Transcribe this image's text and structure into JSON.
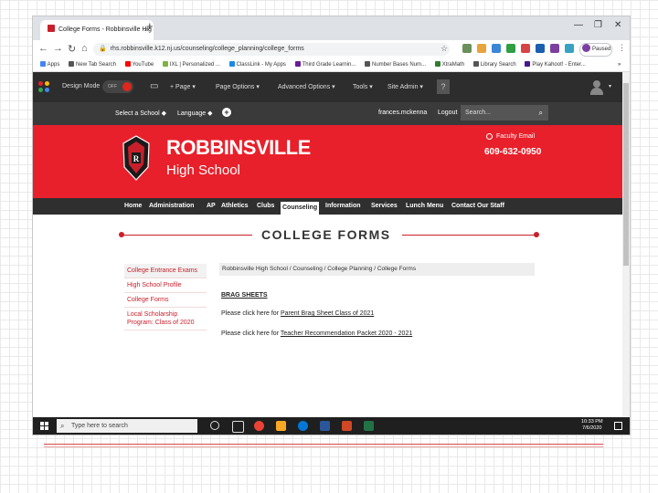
{
  "browser": {
    "tab_title": "College Forms - Robbinsville Hig",
    "tab_close": "×",
    "new_tab": "+",
    "window_controls": [
      "—",
      "❐",
      "✕"
    ],
    "url": "rhs.robbinsville.k12.nj.us/counseling/college_planning/college_forms",
    "profile_label": "Paused",
    "bookmarks": [
      {
        "label": "Apps",
        "color": "#4285f4"
      },
      {
        "label": "New Tab Search",
        "color": "#555555"
      },
      {
        "label": "YouTube",
        "color": "#ff0000"
      },
      {
        "label": "IXL | Personalized ...",
        "color": "#7cb342"
      },
      {
        "label": "ClassLink - My Apps",
        "color": "#1e88e5"
      },
      {
        "label": "Third Grade Learnin...",
        "color": "#6a1b9a"
      },
      {
        "label": "Number Bases Num...",
        "color": "#555555"
      },
      {
        "label": "XtraMath",
        "color": "#2e7d32"
      },
      {
        "label": "Library Search",
        "color": "#555555"
      },
      {
        "label": "Play Kahoot! - Enter...",
        "color": "#46178f"
      }
    ],
    "bookmarks_more": "»"
  },
  "admin_bar": {
    "design_mode": "Design Mode",
    "toggle": "OFF",
    "items": [
      "Page",
      "Page Options",
      "Advanced Options",
      "Tools",
      "Site Admin"
    ],
    "help": "?"
  },
  "site_bar": {
    "select_school": "Select a School",
    "language": "Language",
    "username": "frances.mckenna",
    "logout": "Logout",
    "search_placeholder": "Search..."
  },
  "header": {
    "school_name": "ROBBINSVILLE",
    "school_sub": "High School",
    "faculty_email": "Faculty Email",
    "phone": "609-632-0950"
  },
  "main_nav": [
    "Home",
    "Administration",
    "AP",
    "Athletics",
    "Clubs",
    "Counseling",
    "Information",
    "Services",
    "Lunch Menu",
    "Contact Our Staff"
  ],
  "main_nav_active": "Counseling",
  "page": {
    "title": "COLLEGE FORMS",
    "breadcrumb": "Robbinsville High School / Counseling / College Planning / College Forms",
    "side_menu": [
      "College Entrance Exams",
      "High School Profile",
      "College Forms",
      "Local Scholarship Program: Class of 2020"
    ],
    "brag_heading": "BRAG SHEETS",
    "line1_prefix": "Please click here for ",
    "line1_link": "Parent Brag Sheet Class of 2021",
    "line2_prefix": "Please click here for ",
    "line2_link": "Teacher Recommendation Packet 2020 - 2021"
  },
  "taskbar": {
    "search_text": "Type here to search",
    "time": "10:33 PM",
    "date": "7/6/2020",
    "app_colors": [
      "#dddddd",
      "#dddddd",
      "#ea4335",
      "#f9a825",
      "#0078d7",
      "#2b579a",
      "#d24726",
      "#217346"
    ]
  }
}
